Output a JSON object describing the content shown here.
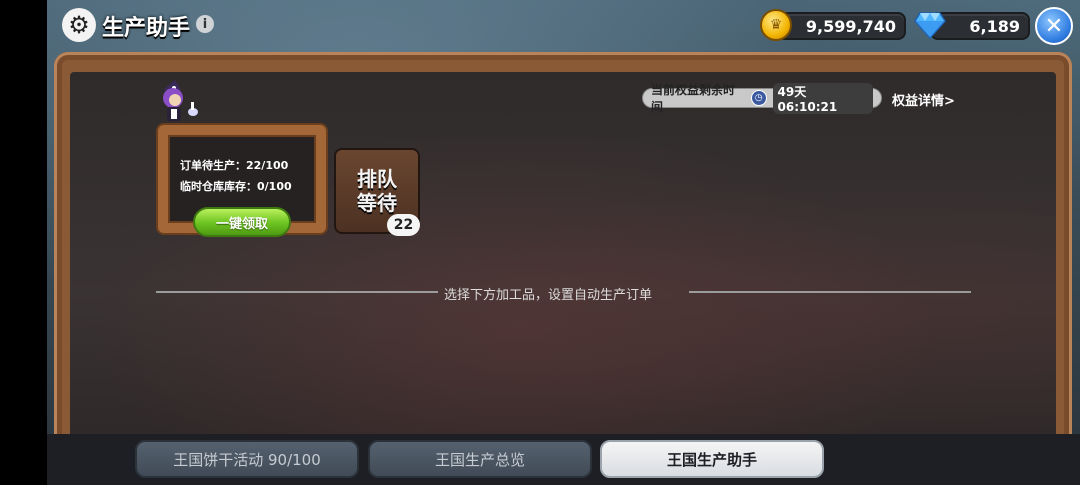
{
  "header": {
    "title": "生产助手",
    "info_icon": "info-icon",
    "gear_icon": "gear-icon"
  },
  "currency": {
    "coins": "9,599,740",
    "gems": "6,189"
  },
  "close_icon": "close-icon",
  "rights": {
    "label": "当前权益剩余时间",
    "remaining": "49天 06:10:21",
    "details_link": "权益详情>"
  },
  "board": {
    "pending_orders": "订单待生产：22/100",
    "temp_storage": "临时仓库库存：0/100",
    "claim_button": "一键领取"
  },
  "queue": {
    "line1": "排队",
    "line2": "等待",
    "count": "22"
  },
  "hint": "选择下方加工品，设置自动生产订单",
  "tabs": [
    {
      "label": "王国饼干活动 90/100",
      "active": false
    },
    {
      "label": "王国生产总览",
      "active": false
    },
    {
      "label": "王国生产助手",
      "active": true
    }
  ],
  "colors": {
    "claim_green": "#6cc321",
    "wood": "#a46838",
    "close_blue": "#2f7ce0"
  }
}
